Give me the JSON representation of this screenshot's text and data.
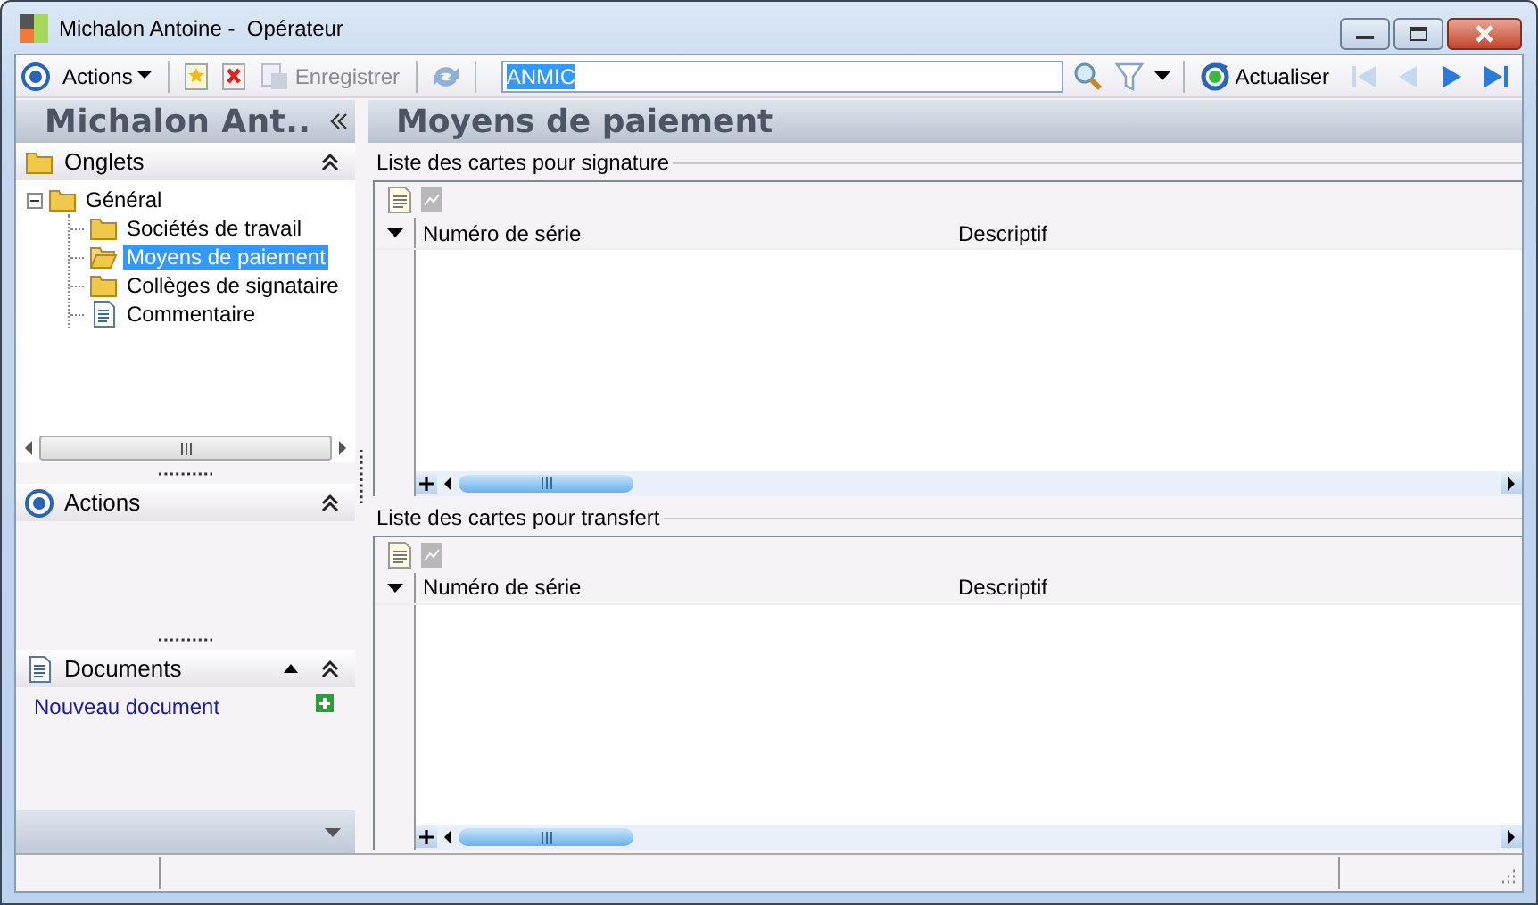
{
  "window": {
    "title": "Michalon Antoine -  Opérateur"
  },
  "toolbar": {
    "actions_menu": "Actions",
    "save": {
      "label": "Enregistrer",
      "disabled": true
    },
    "search": {
      "value": "ANMIC",
      "text_selected": true
    },
    "refresh": "Actualiser",
    "navigation": [
      {
        "kind": "first",
        "disabled": true
      },
      {
        "kind": "previous",
        "disabled": true
      },
      {
        "kind": "next",
        "disabled": false
      },
      {
        "kind": "last",
        "disabled": false
      }
    ]
  },
  "sidebar": {
    "title": "Michalon Ant..",
    "panels": [
      {
        "kind": "tree",
        "title": "Onglets",
        "expanded": true
      },
      {
        "kind": "actions",
        "title": "Actions",
        "expanded": true
      },
      {
        "kind": "documents",
        "title": "Documents",
        "expanded": true
      }
    ],
    "tree": {
      "label": "Général",
      "expanded": true,
      "selected": false,
      "kind": "folder",
      "children": [
        {
          "label": "Sociétés de travail",
          "kind": "folder",
          "selected": false
        },
        {
          "label": "Moyens de paiement",
          "kind": "folder",
          "selected": true
        },
        {
          "label": "Collèges de signataire",
          "kind": "folder",
          "selected": false
        },
        {
          "label": "Commentaire",
          "kind": "document",
          "selected": false
        }
      ]
    },
    "documents": {
      "link": "Nouveau document"
    }
  },
  "main": {
    "title": "Moyens de paiement",
    "groups": [
      {
        "title": "Liste des cartes pour signature",
        "columns": [
          "Numéro de série",
          "Descriptif"
        ]
      },
      {
        "title": "Liste des cartes pour transfert",
        "columns": [
          "Numéro de série",
          "Descriptif"
        ]
      }
    ]
  }
}
